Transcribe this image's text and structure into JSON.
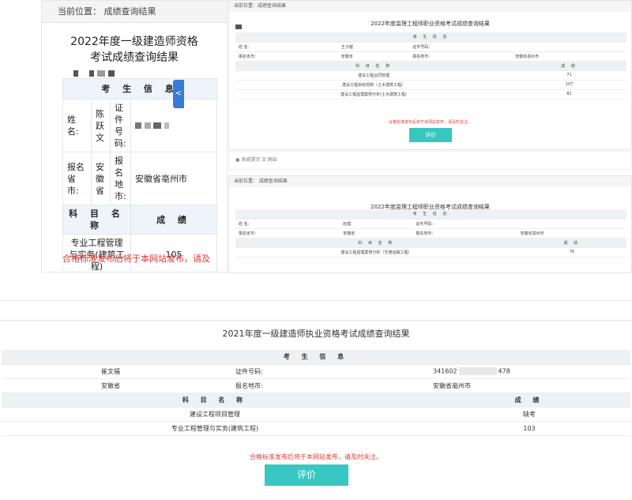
{
  "panelA": {
    "location": "当前位置：  成绩查询结果",
    "title": "2022年度一级建造师资格考试成绩查询结果",
    "section_header": "考 生 信 息",
    "side_tab": "<",
    "rows": [
      {
        "label": "姓名:",
        "value": "陈跃文",
        "label2": "证件号码:"
      },
      {
        "label": "报名省市:",
        "value": "安徽省",
        "label2": "报名地市:",
        "value2": "安徽省亳州市"
      }
    ],
    "subject_header": "科 目 名 称",
    "score_header": "成 绩",
    "subjects": [
      {
        "name": "专业工程管理与实务(建筑工程)",
        "score": "105"
      }
    ],
    "notice": "合格标准发布后将于本网站发布，请及"
  },
  "panelB": {
    "location": "当前位置：成绩查询结果",
    "title": "2022年度监理工程师职业资格考试成绩查询结果",
    "section_header": "考 生 信 息",
    "rows": [
      [
        "姓    名：",
        "王子健",
        "证件号码：",
        ""
      ],
      [
        "报名省市：",
        "安徽省",
        "报名地市：",
        "安徽省亳州市"
      ]
    ],
    "subject_header": "科 目 名 称",
    "score_header": "成 绩",
    "subjects": [
      {
        "name": "建设工程合同管理",
        "score": "71"
      },
      {
        "name": "建设工程目标控制（土木建筑工程）",
        "score": "107"
      },
      {
        "name": "建设工程监理案例分析(土木建筑工程)",
        "score": "82"
      }
    ],
    "notice": "合格标准发布后将于本网站发布，请及时关注。",
    "button": "评价"
  },
  "strip": {
    "text": "▣ 系统提示  ☰ 网站"
  },
  "panelC": {
    "location": "当前位置：  成绩查询结果",
    "title": "2022年度监理工程师职业资格考试成绩查询结果",
    "section_header": "考 生 信 息",
    "rows": [
      [
        "姓    名：",
        "赵斌",
        "证件号码：",
        ""
      ],
      [
        "报名省市：",
        "安徽省",
        "报名地市：",
        "安徽省亳州市"
      ]
    ],
    "subject_header": "科 目 名 称",
    "score_header": "成 绩",
    "subjects": [
      {
        "name": "建设工程监理案例分析（交通运输工程）",
        "score": "76"
      }
    ]
  },
  "panelD": {
    "title": "2021年度一级建造师执业资格考试成绩查询结果",
    "section_header": "考 生 信 息",
    "name": "崔文福",
    "id_label": "证件号码:",
    "id_prefix": "341602",
    "id_suffix": "478",
    "province": "安徽省",
    "city_label": "报名地市:",
    "city": "安徽省亳州市",
    "subject_header": "科 目 名 称",
    "score_header": "成 绩",
    "subjects": [
      {
        "name": "建设工程项目管理",
        "score": "缺考"
      },
      {
        "name": "专业工程管理与实务(建筑工程)",
        "score": "103"
      }
    ],
    "notice": "合格标准发布后将于本网站发布，请及时关注。",
    "button": "评价"
  }
}
